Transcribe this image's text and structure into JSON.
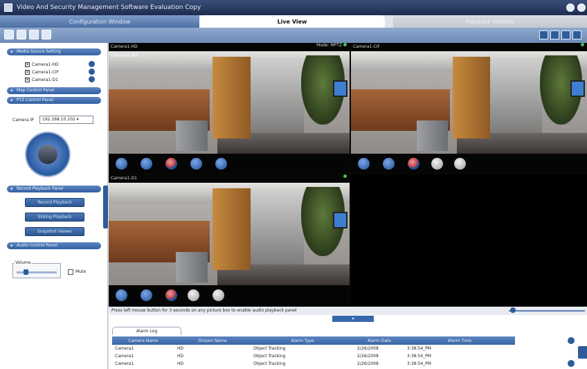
{
  "window": {
    "title": "Video And Security Management Software Evaluation Copy"
  },
  "tabs": [
    {
      "label": "Configuration Window"
    },
    {
      "label": "Live View"
    },
    {
      "label": "Playback Window"
    }
  ],
  "sidebar": {
    "sections": {
      "media_source": "Media Source Setting",
      "map_control": "Map Control Panel",
      "ptz_control": "PTZ Control Panel",
      "record_playback": "Record Playback Panel",
      "audio_control": "Audio Control Panel"
    },
    "cameras": [
      {
        "label": "Camera1-HD",
        "checked": true
      },
      {
        "label": "Camera1-CIF",
        "checked": true
      },
      {
        "label": "Camera1-D1",
        "checked": true
      }
    ],
    "camera_ip_label": "Camera IP",
    "camera_ip_value": "192.168.10.102",
    "playback_buttons": [
      "Record Playback",
      "Sliding Playback",
      "Snapshot Viewer"
    ],
    "volume_label": "Volume",
    "mute_label": "Mute"
  },
  "panes": [
    {
      "name": "Camera1-HD",
      "status": "Mode: MPTZ",
      "overlay": "Camera1-HD",
      "controls": [
        "blue",
        "blue",
        "red",
        "blue",
        "blue"
      ]
    },
    {
      "name": "Camera1-CIF",
      "status": "",
      "overlay": "",
      "controls": [
        "blue",
        "blue",
        "red",
        "gray",
        "gray"
      ]
    },
    {
      "name": "Camera1-D1",
      "status": "",
      "overlay": "",
      "controls": [
        "blue",
        "blue",
        "red",
        "gray",
        "gray"
      ]
    }
  ],
  "hint": "Press left mouse button for 3 seconds on any picture box to enable audio playback panel",
  "alarm_log": {
    "tab_label": "Alarm Log",
    "columns": [
      "Camera Name",
      "Stream Name",
      "Alarm Type",
      "Alarm Date",
      "Alarm Time"
    ],
    "rows": [
      [
        "Camera1",
        "HD",
        "Object Tracking",
        "2/26/2008",
        "3:38:54_PM"
      ],
      [
        "Camera1",
        "HD",
        "Object Tracking",
        "2/26/2008",
        "3:38:54_PM"
      ],
      [
        "Camera1",
        "HD",
        "Object Tracking",
        "2/26/2008",
        "3:38:54_PM"
      ]
    ]
  },
  "colors": {
    "accent": "#2f5b98",
    "status_ok": "#46c34b"
  }
}
